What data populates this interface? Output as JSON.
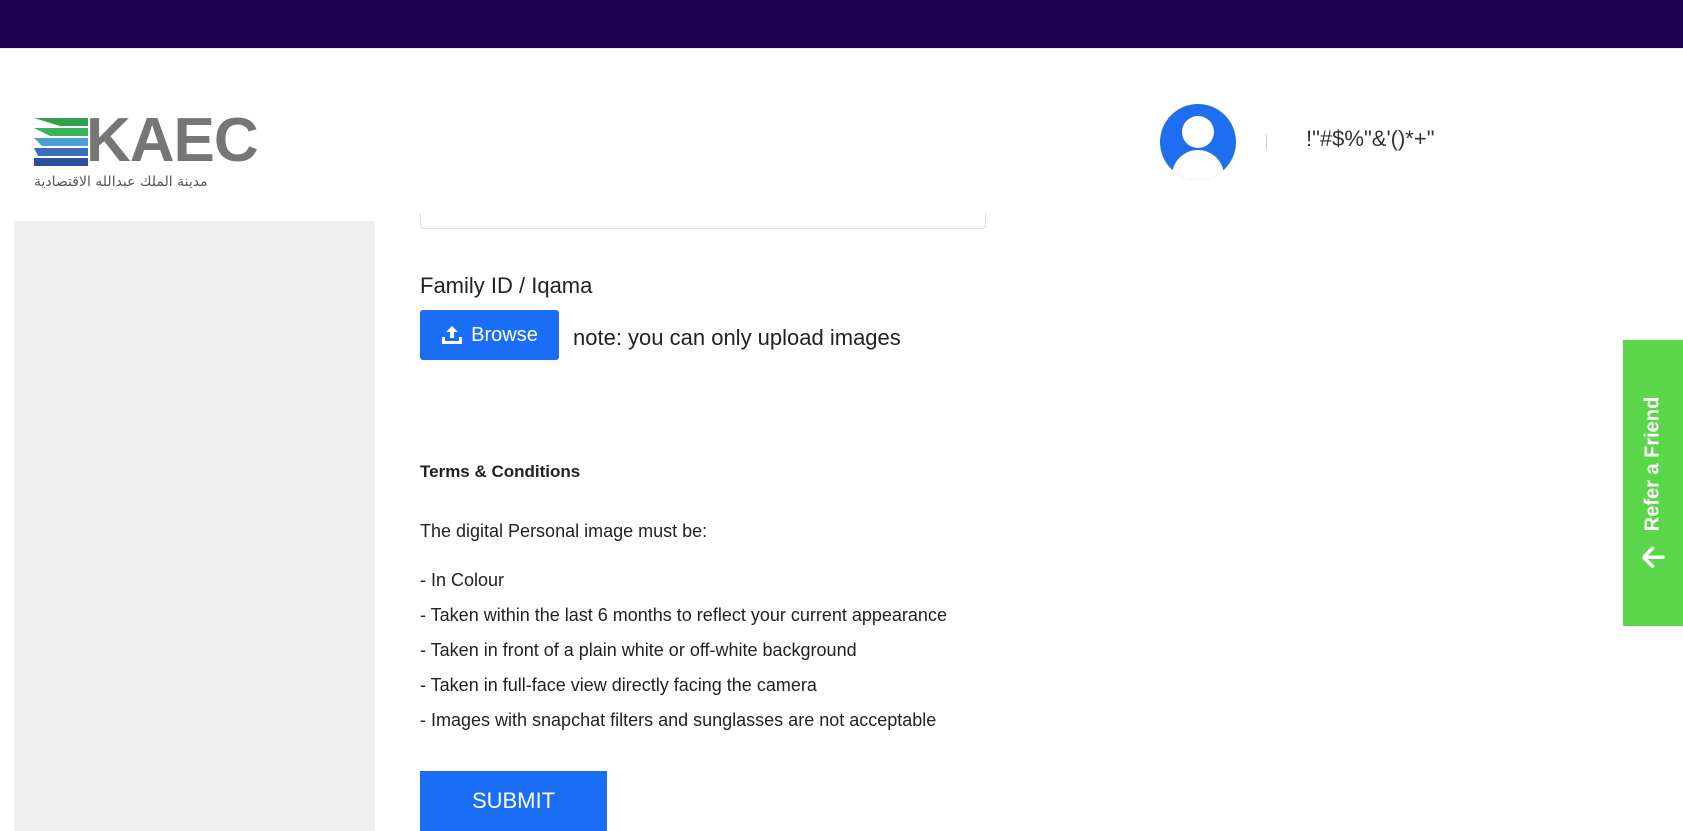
{
  "header": {
    "logo_text": "KAEC",
    "logo_arabic": "مدينة الملك عبدالله الاقتصادية",
    "user_name": "!\"#$%\"&'()*+\""
  },
  "form": {
    "field_label": "Family ID / Iqama",
    "browse_label": "Browse",
    "upload_note": "note: you can only upload images",
    "submit_label": "SUBMIT"
  },
  "terms": {
    "title": "Terms & Conditions",
    "intro": "The digital Personal image must be:",
    "items": [
      "- In Colour",
      "- Taken within the last 6 months to reflect your current appearance",
      "- Taken in front of a plain white or off-white background",
      "- Taken in full-face view directly facing the camera",
      "- Images with snapchat filters and sunglasses are not acceptable"
    ]
  },
  "refer_tab": {
    "label": "Refer a Friend"
  },
  "icons": {
    "avatar": "user-avatar-icon",
    "upload": "upload-icon",
    "arrow": "arrow-left-icon"
  },
  "colors": {
    "topbar": "#1d0050",
    "primary_button": "#1a6ef5",
    "refer_tab": "#59d64a",
    "sidebar": "#efefef"
  }
}
